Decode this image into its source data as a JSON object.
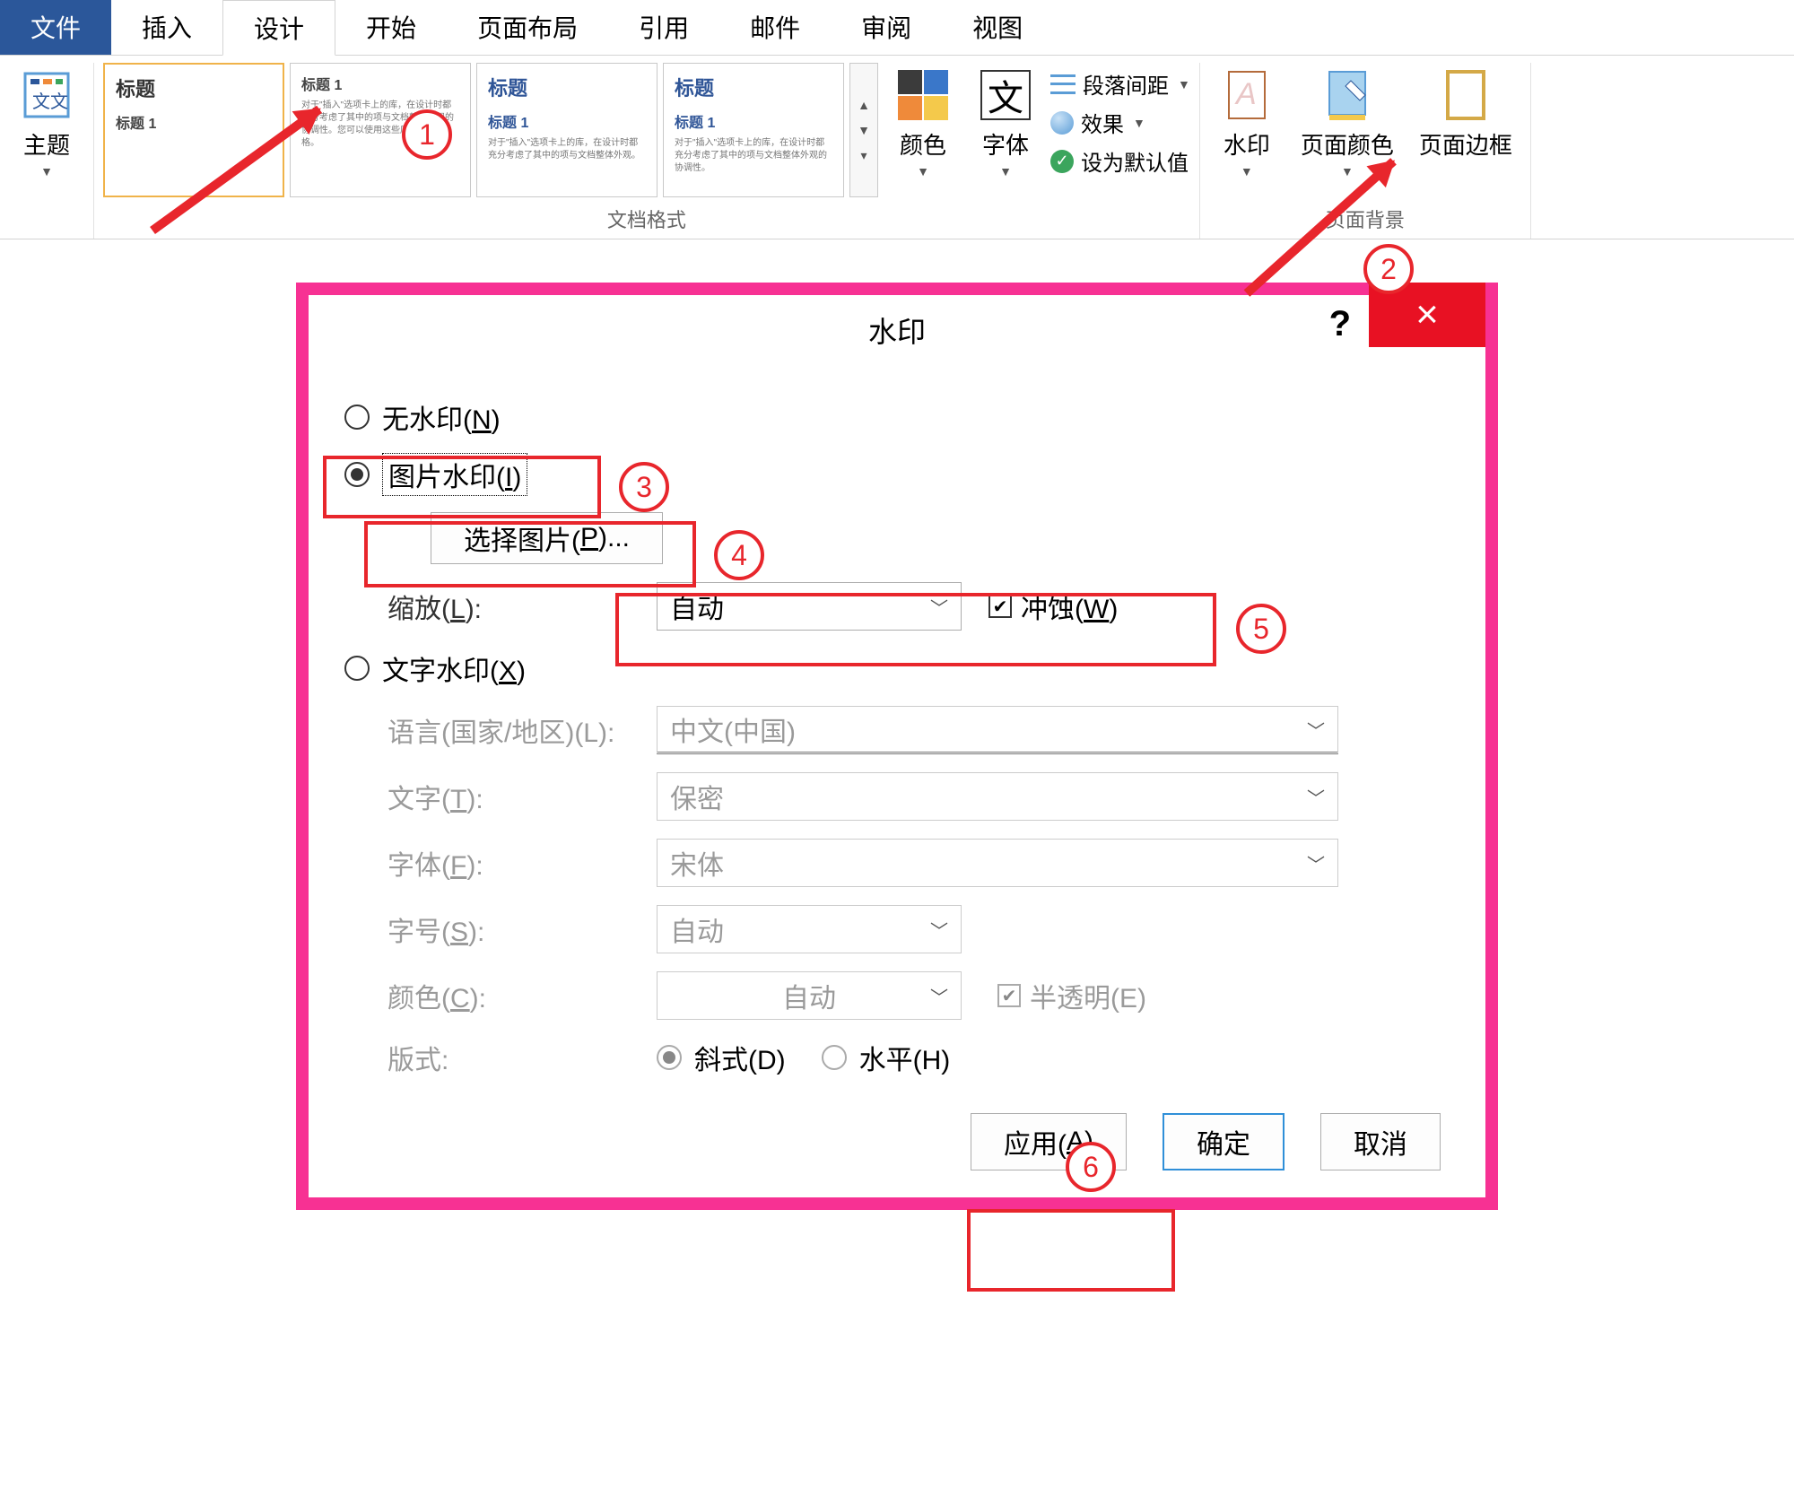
{
  "ribbon": {
    "tabs": {
      "file": "文件",
      "insert": "插入",
      "design": "设计",
      "home": "开始",
      "layout": "页面布局",
      "references": "引用",
      "mailings": "邮件",
      "review": "审阅",
      "view": "视图"
    },
    "themes_btn": "主题",
    "gallery_heading": "标题",
    "gallery_sub": "标题 1",
    "group_doc_format": "文档格式",
    "colors_btn": "颜色",
    "fonts_btn": "字体",
    "fonts_glyph": "文",
    "para_spacing": "段落间距",
    "effects": "效果",
    "set_default": "设为默认值",
    "watermark_btn": "水印",
    "page_color_btn": "页面颜色",
    "page_border_btn": "页面边框",
    "group_page_bg": "页面背景"
  },
  "annotations": {
    "n1": "1",
    "n2": "2",
    "n3": "3",
    "n4": "4",
    "n5": "5",
    "n6": "6"
  },
  "dialog": {
    "title": "水印",
    "help": "?",
    "close": "×",
    "opt_none": "无水印(",
    "opt_none_key": "N",
    "opt_pic": "图片水印(",
    "opt_pic_key": "I",
    "select_pic": "选择图片(",
    "select_pic_key": "P",
    "select_pic_tail": ")...",
    "scale_label": "缩放(",
    "scale_key": "L",
    "scale_tail": "):",
    "scale_value": "自动",
    "washout_label": "冲蚀(",
    "washout_key": "W",
    "opt_text": "文字水印(",
    "opt_text_key": "X",
    "lang_label": "语言(国家/地区)(L):",
    "lang_value": "中文(中国)",
    "text_label": "文字(",
    "text_key": "T",
    "text_tail": "):",
    "text_value": "保密",
    "font_label": "字体(",
    "font_key": "F",
    "font_tail": "):",
    "font_value": "宋体",
    "size_label": "字号(",
    "size_key": "S",
    "size_tail": "):",
    "size_value": "自动",
    "color_label": "颜色(",
    "color_key": "C",
    "color_tail": "):",
    "color_value": "自动",
    "semi_label": "半透明(E)",
    "layout_label": "版式:",
    "diag_label": "斜式(D)",
    "horiz_label": "水平(H)",
    "apply_btn": "应用(",
    "apply_key": "A",
    "ok_btn": "确定",
    "cancel_btn": "取消",
    "paren_close": ")"
  }
}
